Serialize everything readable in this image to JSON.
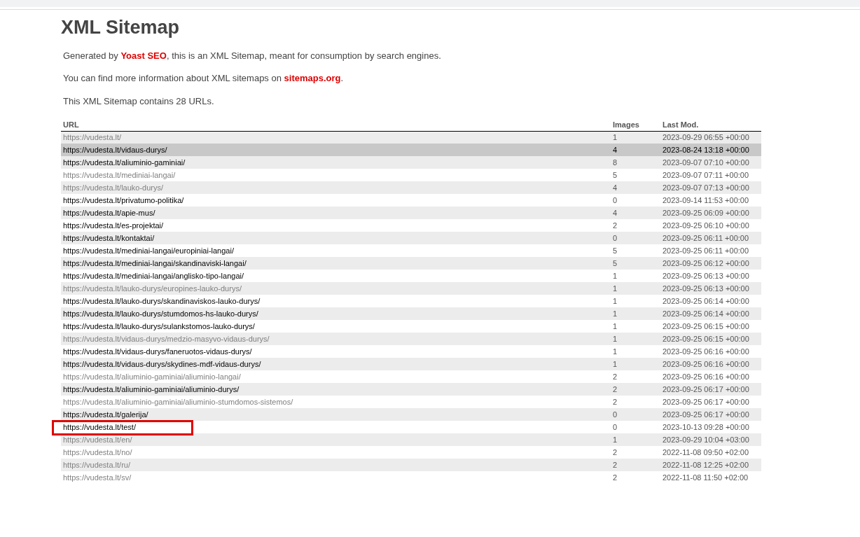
{
  "title": "XML Sitemap",
  "intro": [
    "Generated by **Yoast SEO**, this is an XML Sitemap, meant for consumption by search engines.",
    "You can find more information about XML sitemaps on **sitemaps.org**.",
    "This XML Sitemap contains 28 URLs."
  ],
  "table": {
    "columns": [
      "URL",
      "Images",
      "Last Mod."
    ],
    "rows": [
      {
        "url": "https://vudesta.lt/",
        "images": "1",
        "last_mod": "2023-09-29 06:55 +00:00",
        "visited": true,
        "highlighted": false,
        "annotated": false
      },
      {
        "url": "https://vudesta.lt/vidaus-durys/",
        "images": "4",
        "last_mod": "2023-08-24 13:18 +00:00",
        "visited": false,
        "highlighted": true,
        "annotated": false
      },
      {
        "url": "https://vudesta.lt/aliuminio-gaminiai/",
        "images": "8",
        "last_mod": "2023-09-07 07:10 +00:00",
        "visited": false,
        "highlighted": false,
        "annotated": false
      },
      {
        "url": "https://vudesta.lt/mediniai-langai/",
        "images": "5",
        "last_mod": "2023-09-07 07:11 +00:00",
        "visited": true,
        "highlighted": false,
        "annotated": false
      },
      {
        "url": "https://vudesta.lt/lauko-durys/",
        "images": "4",
        "last_mod": "2023-09-07 07:13 +00:00",
        "visited": true,
        "highlighted": false,
        "annotated": false
      },
      {
        "url": "https://vudesta.lt/privatumo-politika/",
        "images": "0",
        "last_mod": "2023-09-14 11:53 +00:00",
        "visited": false,
        "highlighted": false,
        "annotated": false
      },
      {
        "url": "https://vudesta.lt/apie-mus/",
        "images": "4",
        "last_mod": "2023-09-25 06:09 +00:00",
        "visited": false,
        "highlighted": false,
        "annotated": false
      },
      {
        "url": "https://vudesta.lt/es-projektai/",
        "images": "2",
        "last_mod": "2023-09-25 06:10 +00:00",
        "visited": false,
        "highlighted": false,
        "annotated": false
      },
      {
        "url": "https://vudesta.lt/kontaktai/",
        "images": "0",
        "last_mod": "2023-09-25 06:11 +00:00",
        "visited": false,
        "highlighted": false,
        "annotated": false
      },
      {
        "url": "https://vudesta.lt/mediniai-langai/europiniai-langai/",
        "images": "5",
        "last_mod": "2023-09-25 06:11 +00:00",
        "visited": false,
        "highlighted": false,
        "annotated": false
      },
      {
        "url": "https://vudesta.lt/mediniai-langai/skandinaviski-langai/",
        "images": "5",
        "last_mod": "2023-09-25 06:12 +00:00",
        "visited": false,
        "highlighted": false,
        "annotated": false
      },
      {
        "url": "https://vudesta.lt/mediniai-langai/anglisko-tipo-langai/",
        "images": "1",
        "last_mod": "2023-09-25 06:13 +00:00",
        "visited": false,
        "highlighted": false,
        "annotated": false
      },
      {
        "url": "https://vudesta.lt/lauko-durys/europines-lauko-durys/",
        "images": "1",
        "last_mod": "2023-09-25 06:13 +00:00",
        "visited": true,
        "highlighted": false,
        "annotated": false
      },
      {
        "url": "https://vudesta.lt/lauko-durys/skandinaviskos-lauko-durys/",
        "images": "1",
        "last_mod": "2023-09-25 06:14 +00:00",
        "visited": false,
        "highlighted": false,
        "annotated": false
      },
      {
        "url": "https://vudesta.lt/lauko-durys/stumdomos-hs-lauko-durys/",
        "images": "1",
        "last_mod": "2023-09-25 06:14 +00:00",
        "visited": false,
        "highlighted": false,
        "annotated": false
      },
      {
        "url": "https://vudesta.lt/lauko-durys/sulankstomos-lauko-durys/",
        "images": "1",
        "last_mod": "2023-09-25 06:15 +00:00",
        "visited": false,
        "highlighted": false,
        "annotated": false
      },
      {
        "url": "https://vudesta.lt/vidaus-durys/medzio-masyvo-vidaus-durys/",
        "images": "1",
        "last_mod": "2023-09-25 06:15 +00:00",
        "visited": true,
        "highlighted": false,
        "annotated": false
      },
      {
        "url": "https://vudesta.lt/vidaus-durys/faneruotos-vidaus-durys/",
        "images": "1",
        "last_mod": "2023-09-25 06:16 +00:00",
        "visited": false,
        "highlighted": false,
        "annotated": false
      },
      {
        "url": "https://vudesta.lt/vidaus-durys/skydines-mdf-vidaus-durys/",
        "images": "1",
        "last_mod": "2023-09-25 06:16 +00:00",
        "visited": false,
        "highlighted": false,
        "annotated": false
      },
      {
        "url": "https://vudesta.lt/aliuminio-gaminiai/aliuminio-langai/",
        "images": "2",
        "last_mod": "2023-09-25 06:16 +00:00",
        "visited": true,
        "highlighted": false,
        "annotated": false
      },
      {
        "url": "https://vudesta.lt/aliuminio-gaminiai/aliuminio-durys/",
        "images": "2",
        "last_mod": "2023-09-25 06:17 +00:00",
        "visited": false,
        "highlighted": false,
        "annotated": false
      },
      {
        "url": "https://vudesta.lt/aliuminio-gaminiai/aliuminio-stumdomos-sistemos/",
        "images": "2",
        "last_mod": "2023-09-25 06:17 +00:00",
        "visited": true,
        "highlighted": false,
        "annotated": false
      },
      {
        "url": "https://vudesta.lt/galerija/",
        "images": "0",
        "last_mod": "2023-09-25 06:17 +00:00",
        "visited": false,
        "highlighted": false,
        "annotated": false
      },
      {
        "url": "https://vudesta.lt/test/",
        "images": "0",
        "last_mod": "2023-10-13 09:28 +00:00",
        "visited": false,
        "highlighted": false,
        "annotated": true
      },
      {
        "url": "https://vudesta.lt/en/",
        "images": "1",
        "last_mod": "2023-09-29 10:04 +03:00",
        "visited": true,
        "highlighted": false,
        "annotated": false
      },
      {
        "url": "https://vudesta.lt/no/",
        "images": "2",
        "last_mod": "2022-11-08 09:50 +02:00",
        "visited": true,
        "highlighted": false,
        "annotated": false
      },
      {
        "url": "https://vudesta.lt/ru/",
        "images": "2",
        "last_mod": "2022-11-08 12:25 +02:00",
        "visited": true,
        "highlighted": false,
        "annotated": false
      },
      {
        "url": "https://vudesta.lt/sv/",
        "images": "2",
        "last_mod": "2022-11-08 11:50 +02:00",
        "visited": true,
        "highlighted": false,
        "annotated": false
      }
    ]
  }
}
